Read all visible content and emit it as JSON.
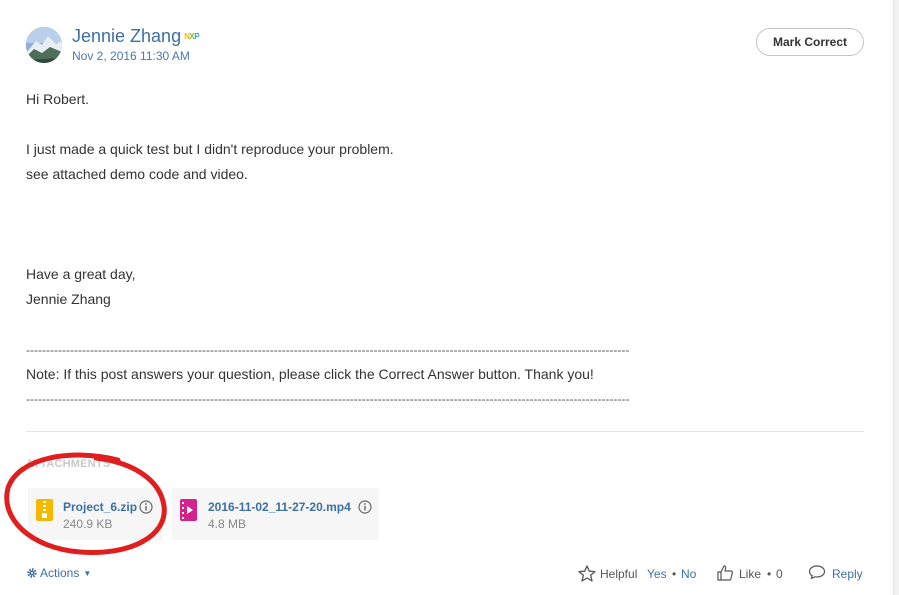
{
  "post": {
    "author": "Jennie Zhang",
    "badge": {
      "n": "N",
      "x": "X",
      "p": "P"
    },
    "date": "Nov 2, 2016 11:30 AM",
    "mark_correct_label": "Mark Correct",
    "body": {
      "greeting": "Hi Robert.",
      "line1": "I just made a quick test but I didn't reproduce your problem.",
      "line2": "see attached demo code and video.",
      "closing": "Have a great day,",
      "signature": "Jennie Zhang",
      "separator": "-------------------------------------------------------------------------------------------------------------------------------------------------------",
      "note": "Note: If this post answers your question, please click the Correct Answer button. Thank you!"
    }
  },
  "attachments": {
    "heading": "ATTACHMENTS",
    "items": [
      {
        "name": "Project_6.zip",
        "size": "240.9 KB",
        "icon": "zip-file-icon",
        "color": "#f5b800"
      },
      {
        "name": "2016-11-02_11-27-20.mp4",
        "size": "4.8 MB",
        "icon": "video-file-icon",
        "color": "#d4238a"
      }
    ]
  },
  "footer": {
    "actions_label": "Actions",
    "helpful_label": "Helpful",
    "yes_label": "Yes",
    "dot": "•",
    "no_label": "No",
    "like_label": "Like",
    "like_count": "0",
    "reply_label": "Reply"
  },
  "colors": {
    "link": "#3d6fa3",
    "annotation_circle": "#e01e1e"
  }
}
